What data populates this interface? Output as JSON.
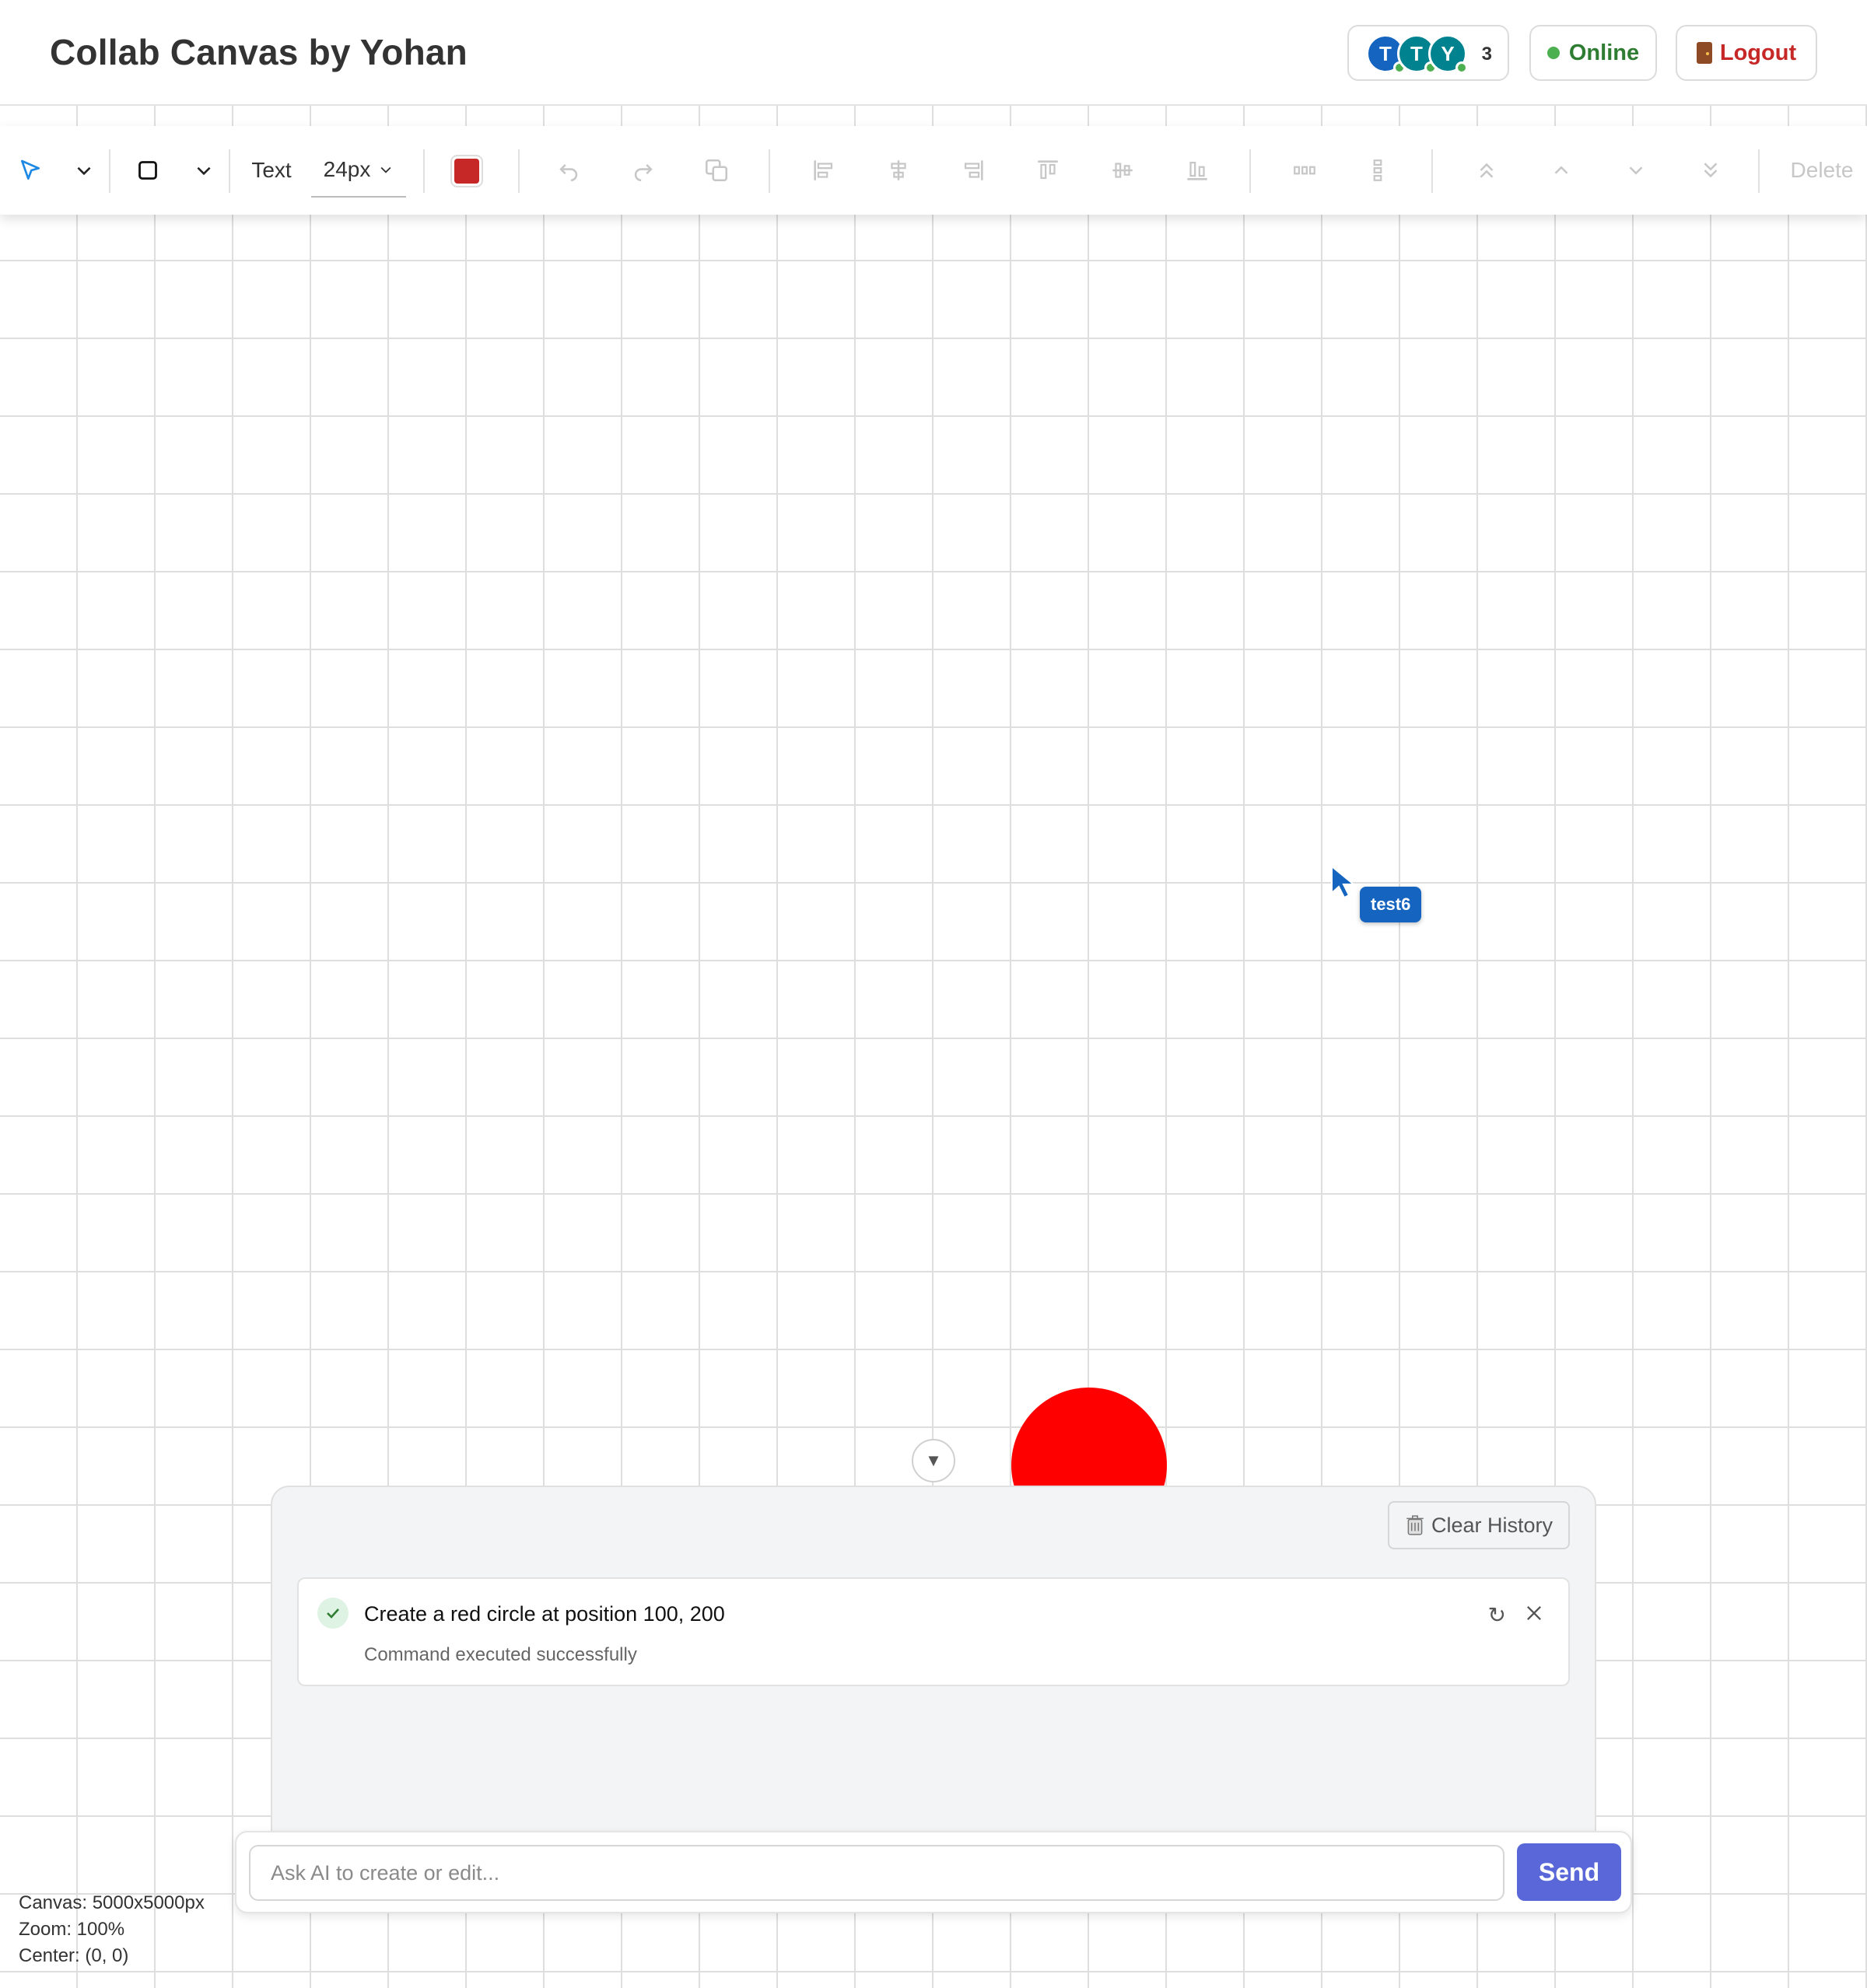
{
  "header": {
    "title": "Collab Canvas by Yohan",
    "presence": {
      "avatars": [
        {
          "initial": "T",
          "color": "#1565c0"
        },
        {
          "initial": "T",
          "color": "#00838f"
        },
        {
          "initial": "Y",
          "color": "#00838f"
        }
      ],
      "count": "3"
    },
    "status_label": "Online",
    "logout_label": "Logout"
  },
  "toolbar": {
    "text_tool_label": "Text",
    "font_size": "24px",
    "fill_color": "#c62828",
    "delete_label": "Delete"
  },
  "canvas": {
    "shape_color": "#ff0000",
    "remote_cursor": {
      "user": "test6",
      "color": "#1565c0"
    },
    "info": {
      "size": "Canvas: 5000x5000px",
      "zoom": "Zoom: 100%",
      "center": "Center: (0, 0)"
    }
  },
  "ai_panel": {
    "collapse_glyph": "▼",
    "clear_history_label": "Clear History",
    "history": [
      {
        "command": "Create a red circle at position 100, 200",
        "status": "Command executed successfully"
      }
    ],
    "input_placeholder": "Ask AI to create or edit...",
    "send_label": "Send"
  }
}
